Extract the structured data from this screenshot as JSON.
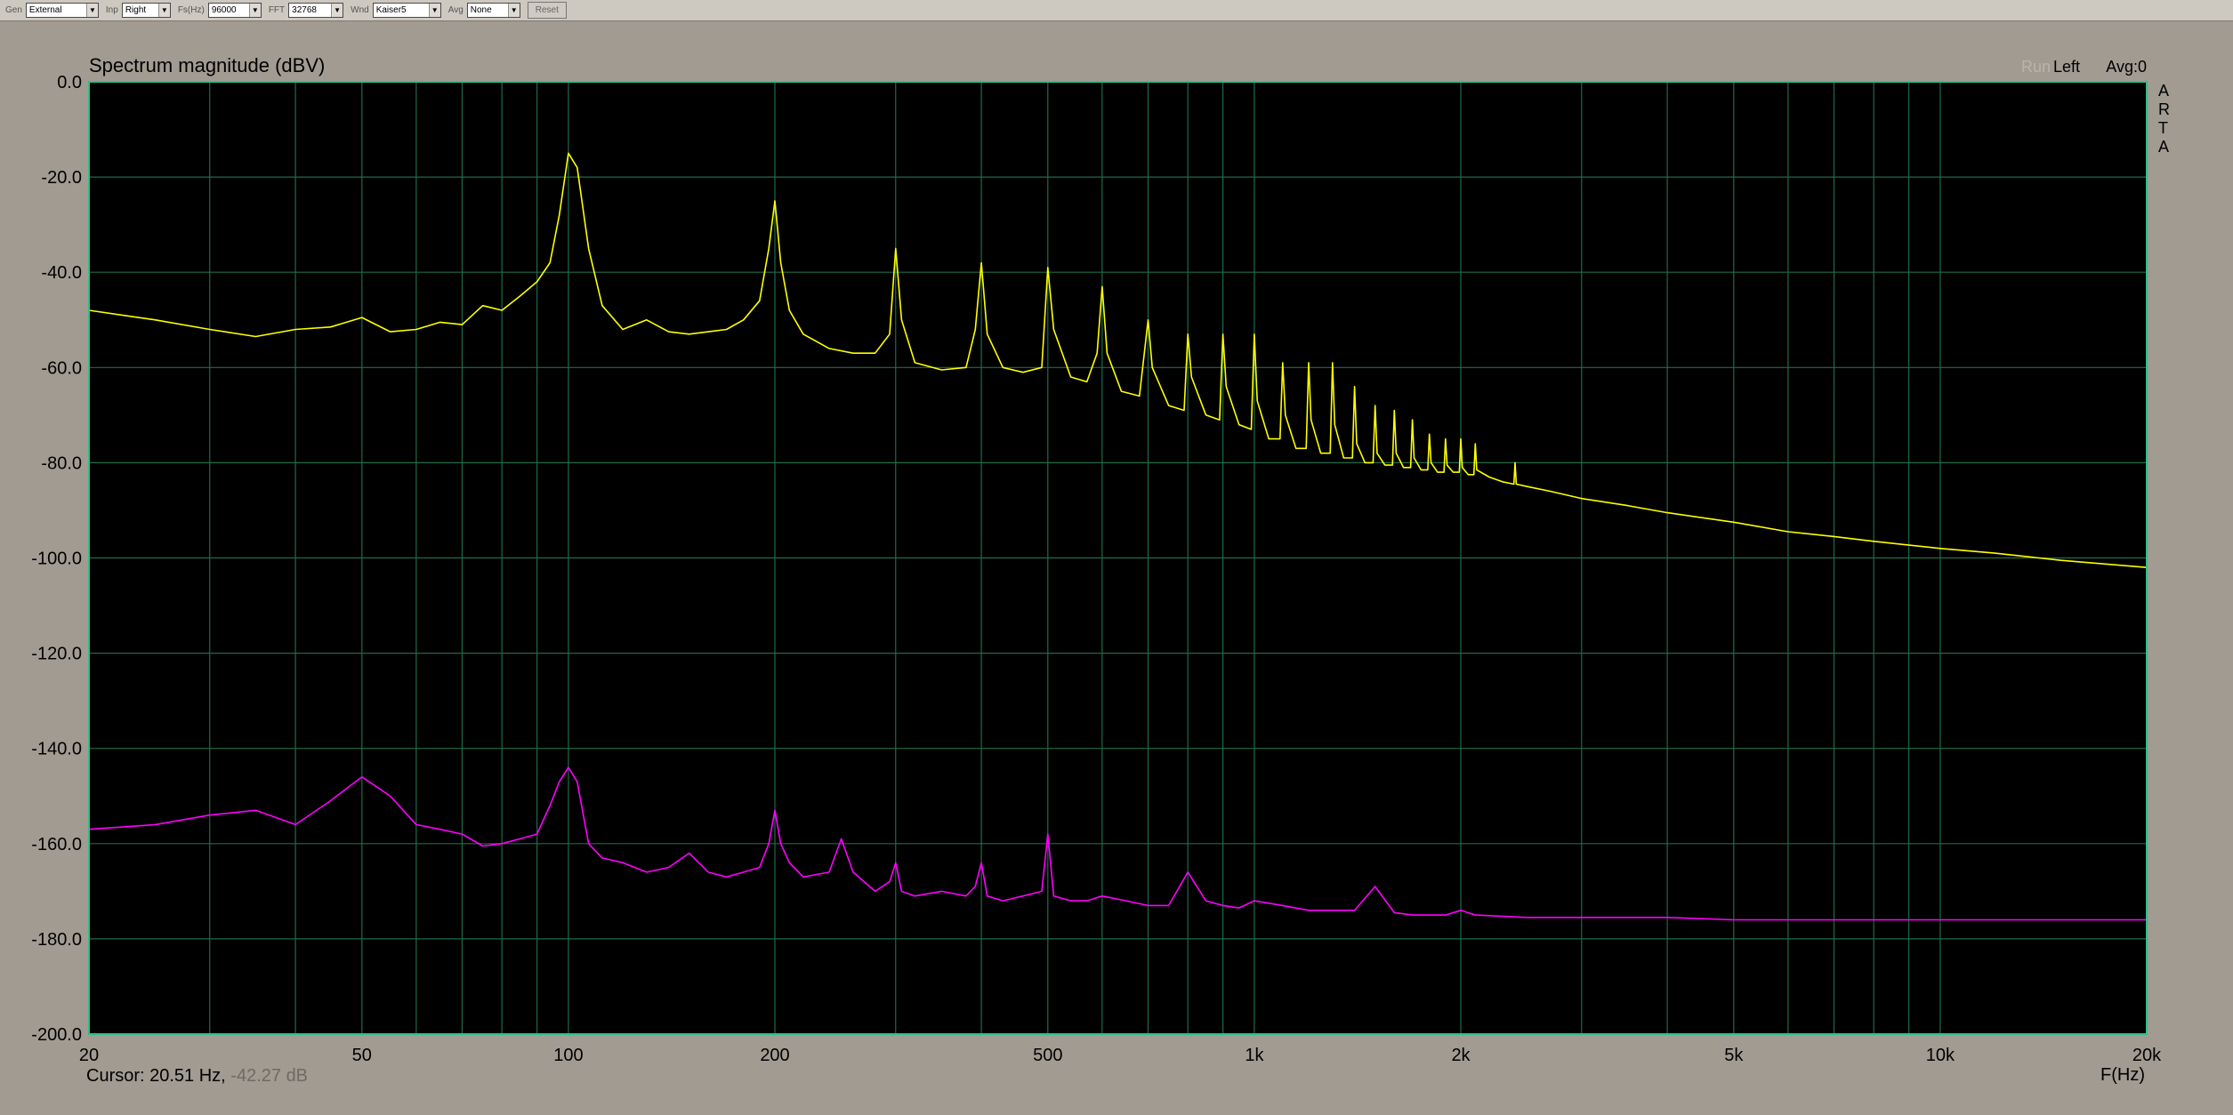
{
  "toolbar": {
    "gen": {
      "label": "Gen",
      "value": "External"
    },
    "inp": {
      "label": "Inp",
      "value": "Right"
    },
    "fs": {
      "label": "Fs(Hz)",
      "value": "96000"
    },
    "fft": {
      "label": "FFT",
      "value": "32768"
    },
    "wnd": {
      "label": "Wnd",
      "value": "Kaiser5"
    },
    "avg": {
      "label": "Avg",
      "value": "None"
    },
    "reset_label": "Reset"
  },
  "plot": {
    "status_ghost": "Run",
    "status_left": "Left",
    "avg_status": "Avg:0",
    "brand_letters": [
      "A",
      "R",
      "T",
      "A"
    ],
    "cursor_prefix": "Cursor: 20.51 Hz,",
    "cursor_value": "-42.27 dB"
  },
  "colors": {
    "plot_background": "#000000",
    "grid": "#1e6b48",
    "frame": "#2fbf88",
    "window_background": "#a19b92",
    "series_right": "#ffff00",
    "series_left": "#ff00ff"
  },
  "chart_data": {
    "type": "line",
    "title": "Spectrum magnitude (dBV)",
    "xlabel": "F(Hz)",
    "x_scale": "log",
    "xlim": [
      20,
      20000
    ],
    "ylim": [
      -200,
      0
    ],
    "x_ticks": [
      20,
      50,
      100,
      200,
      500,
      1000,
      2000,
      5000,
      10000,
      20000
    ],
    "x_tick_labels": [
      "20",
      "50",
      "100",
      "200",
      "500",
      "1k",
      "2k",
      "5k",
      "10k",
      "20k"
    ],
    "y_ticks": [
      0,
      -20,
      -40,
      -60,
      -80,
      -100,
      -120,
      -140,
      -160,
      -180,
      -200
    ],
    "y_tick_labels": [
      "0.0",
      "-20.0",
      "-40.0",
      "-60.0",
      "-80.0",
      "-100.0",
      "-120.0",
      "-140.0",
      "-160.0",
      "-180.0",
      "-200.0"
    ],
    "grid": true,
    "series": [
      {
        "color": "#ffff00",
        "x": [
          20,
          25,
          30,
          35,
          40,
          45,
          50,
          55,
          60,
          65,
          70,
          75,
          80,
          85,
          90,
          94,
          97,
          100,
          103,
          107,
          112,
          120,
          130,
          140,
          150,
          160,
          170,
          180,
          190,
          196,
          200,
          204,
          210,
          220,
          240,
          260,
          280,
          294,
          300,
          306,
          320,
          350,
          380,
          392,
          400,
          408,
          430,
          460,
          490,
          500,
          510,
          540,
          570,
          590,
          600,
          610,
          640,
          680,
          700,
          710,
          750,
          790,
          800,
          810,
          850,
          890,
          900,
          910,
          950,
          990,
          1000,
          1010,
          1050,
          1090,
          1100,
          1110,
          1150,
          1190,
          1200,
          1210,
          1250,
          1290,
          1300,
          1310,
          1350,
          1390,
          1400,
          1410,
          1450,
          1490,
          1500,
          1510,
          1550,
          1590,
          1600,
          1610,
          1650,
          1690,
          1700,
          1710,
          1750,
          1790,
          1800,
          1810,
          1850,
          1890,
          1900,
          1910,
          1950,
          1990,
          2000,
          2010,
          2050,
          2090,
          2100,
          2110,
          2200,
          2300,
          2390,
          2400,
          2410,
          2500,
          2700,
          3000,
          3500,
          4000,
          5000,
          6000,
          7000,
          8000,
          10000,
          12000,
          15000,
          20000
        ],
        "y": [
          -48,
          -50,
          -52,
          -53.5,
          -52,
          -51.5,
          -49.5,
          -52.5,
          -52,
          -50.5,
          -51,
          -47,
          -48,
          -45,
          -42,
          -38,
          -28,
          -15,
          -18,
          -35,
          -47,
          -52,
          -50,
          -52.5,
          -53,
          -52.5,
          -52,
          -50,
          -46,
          -35,
          -25,
          -38,
          -48,
          -53,
          -56,
          -57,
          -57,
          -53,
          -35,
          -50,
          -59,
          -60.5,
          -60,
          -52,
          -38,
          -53,
          -60,
          -61,
          -60,
          -39,
          -52,
          -62,
          -63,
          -57,
          -43,
          -57,
          -65,
          -66,
          -50,
          -60,
          -68,
          -69,
          -53,
          -62,
          -70,
          -71,
          -53,
          -64,
          -72,
          -73,
          -53,
          -67,
          -75,
          -75,
          -59,
          -70,
          -77,
          -77,
          -59,
          -71,
          -78,
          -78,
          -59,
          -72,
          -79,
          -79,
          -64,
          -76,
          -80,
          -80,
          -68,
          -78,
          -80.5,
          -80.5,
          -69,
          -78,
          -81,
          -81,
          -71,
          -79,
          -81.5,
          -81.5,
          -74,
          -80,
          -82,
          -82,
          -75,
          -80.5,
          -82,
          -82,
          -75,
          -81,
          -82.5,
          -82.5,
          -76,
          -81.5,
          -83,
          -84,
          -84.5,
          -80,
          -84.5,
          -85,
          -86,
          -87.5,
          -89,
          -90.5,
          -92.5,
          -94.5,
          -95.5,
          -96.5,
          -98,
          -99,
          -100.5,
          -102
        ]
      },
      {
        "color": "#ff00ff",
        "x": [
          20,
          25,
          30,
          35,
          40,
          45,
          50,
          55,
          60,
          65,
          70,
          75,
          80,
          85,
          90,
          94,
          97,
          100,
          103,
          107,
          112,
          120,
          130,
          140,
          150,
          160,
          170,
          180,
          190,
          196,
          200,
          204,
          210,
          220,
          240,
          250,
          260,
          280,
          294,
          300,
          306,
          320,
          350,
          380,
          392,
          400,
          408,
          430,
          460,
          490,
          500,
          510,
          540,
          570,
          600,
          650,
          700,
          750,
          800,
          850,
          900,
          950,
          1000,
          1100,
          1200,
          1300,
          1400,
          1500,
          1600,
          1700,
          1800,
          1900,
          2000,
          2100,
          2500,
          3000,
          4000,
          5000,
          7000,
          10000,
          15000,
          20000
        ],
        "y": [
          -157,
          -156,
          -154,
          -153,
          -156,
          -151,
          -146,
          -150,
          -156,
          -157,
          -158,
          -160.5,
          -160,
          -159,
          -158,
          -152,
          -147,
          -144,
          -147,
          -160,
          -163,
          -164,
          -166,
          -165,
          -162,
          -166,
          -167,
          -166,
          -165,
          -160,
          -153,
          -160,
          -164,
          -167,
          -166,
          -159,
          -166,
          -170,
          -168,
          -164,
          -170,
          -171,
          -170,
          -171,
          -169,
          -164,
          -171,
          -172,
          -171,
          -170,
          -158,
          -171,
          -172,
          -172,
          -171,
          -172,
          -173,
          -173,
          -166,
          -172,
          -173,
          -173.5,
          -172,
          -173,
          -174,
          -174,
          -174,
          -169,
          -174.5,
          -175,
          -175,
          -175,
          -174,
          -175,
          -175.5,
          -175.5,
          -175.5,
          -176,
          -176,
          -176,
          -176,
          -176
        ]
      }
    ]
  }
}
